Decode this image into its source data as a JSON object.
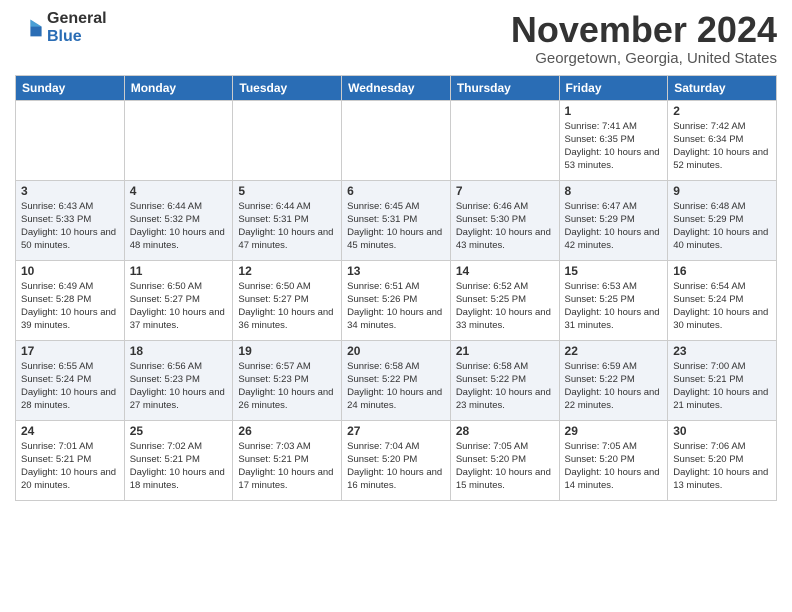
{
  "header": {
    "logo_general": "General",
    "logo_blue": "Blue",
    "month_title": "November 2024",
    "location": "Georgetown, Georgia, United States"
  },
  "weekdays": [
    "Sunday",
    "Monday",
    "Tuesday",
    "Wednesday",
    "Thursday",
    "Friday",
    "Saturday"
  ],
  "weeks": [
    [
      {
        "day": "",
        "info": ""
      },
      {
        "day": "",
        "info": ""
      },
      {
        "day": "",
        "info": ""
      },
      {
        "day": "",
        "info": ""
      },
      {
        "day": "",
        "info": ""
      },
      {
        "day": "1",
        "info": "Sunrise: 7:41 AM\nSunset: 6:35 PM\nDaylight: 10 hours and 53 minutes."
      },
      {
        "day": "2",
        "info": "Sunrise: 7:42 AM\nSunset: 6:34 PM\nDaylight: 10 hours and 52 minutes."
      }
    ],
    [
      {
        "day": "3",
        "info": "Sunrise: 6:43 AM\nSunset: 5:33 PM\nDaylight: 10 hours and 50 minutes."
      },
      {
        "day": "4",
        "info": "Sunrise: 6:44 AM\nSunset: 5:32 PM\nDaylight: 10 hours and 48 minutes."
      },
      {
        "day": "5",
        "info": "Sunrise: 6:44 AM\nSunset: 5:31 PM\nDaylight: 10 hours and 47 minutes."
      },
      {
        "day": "6",
        "info": "Sunrise: 6:45 AM\nSunset: 5:31 PM\nDaylight: 10 hours and 45 minutes."
      },
      {
        "day": "7",
        "info": "Sunrise: 6:46 AM\nSunset: 5:30 PM\nDaylight: 10 hours and 43 minutes."
      },
      {
        "day": "8",
        "info": "Sunrise: 6:47 AM\nSunset: 5:29 PM\nDaylight: 10 hours and 42 minutes."
      },
      {
        "day": "9",
        "info": "Sunrise: 6:48 AM\nSunset: 5:29 PM\nDaylight: 10 hours and 40 minutes."
      }
    ],
    [
      {
        "day": "10",
        "info": "Sunrise: 6:49 AM\nSunset: 5:28 PM\nDaylight: 10 hours and 39 minutes."
      },
      {
        "day": "11",
        "info": "Sunrise: 6:50 AM\nSunset: 5:27 PM\nDaylight: 10 hours and 37 minutes."
      },
      {
        "day": "12",
        "info": "Sunrise: 6:50 AM\nSunset: 5:27 PM\nDaylight: 10 hours and 36 minutes."
      },
      {
        "day": "13",
        "info": "Sunrise: 6:51 AM\nSunset: 5:26 PM\nDaylight: 10 hours and 34 minutes."
      },
      {
        "day": "14",
        "info": "Sunrise: 6:52 AM\nSunset: 5:25 PM\nDaylight: 10 hours and 33 minutes."
      },
      {
        "day": "15",
        "info": "Sunrise: 6:53 AM\nSunset: 5:25 PM\nDaylight: 10 hours and 31 minutes."
      },
      {
        "day": "16",
        "info": "Sunrise: 6:54 AM\nSunset: 5:24 PM\nDaylight: 10 hours and 30 minutes."
      }
    ],
    [
      {
        "day": "17",
        "info": "Sunrise: 6:55 AM\nSunset: 5:24 PM\nDaylight: 10 hours and 28 minutes."
      },
      {
        "day": "18",
        "info": "Sunrise: 6:56 AM\nSunset: 5:23 PM\nDaylight: 10 hours and 27 minutes."
      },
      {
        "day": "19",
        "info": "Sunrise: 6:57 AM\nSunset: 5:23 PM\nDaylight: 10 hours and 26 minutes."
      },
      {
        "day": "20",
        "info": "Sunrise: 6:58 AM\nSunset: 5:22 PM\nDaylight: 10 hours and 24 minutes."
      },
      {
        "day": "21",
        "info": "Sunrise: 6:58 AM\nSunset: 5:22 PM\nDaylight: 10 hours and 23 minutes."
      },
      {
        "day": "22",
        "info": "Sunrise: 6:59 AM\nSunset: 5:22 PM\nDaylight: 10 hours and 22 minutes."
      },
      {
        "day": "23",
        "info": "Sunrise: 7:00 AM\nSunset: 5:21 PM\nDaylight: 10 hours and 21 minutes."
      }
    ],
    [
      {
        "day": "24",
        "info": "Sunrise: 7:01 AM\nSunset: 5:21 PM\nDaylight: 10 hours and 20 minutes."
      },
      {
        "day": "25",
        "info": "Sunrise: 7:02 AM\nSunset: 5:21 PM\nDaylight: 10 hours and 18 minutes."
      },
      {
        "day": "26",
        "info": "Sunrise: 7:03 AM\nSunset: 5:21 PM\nDaylight: 10 hours and 17 minutes."
      },
      {
        "day": "27",
        "info": "Sunrise: 7:04 AM\nSunset: 5:20 PM\nDaylight: 10 hours and 16 minutes."
      },
      {
        "day": "28",
        "info": "Sunrise: 7:05 AM\nSunset: 5:20 PM\nDaylight: 10 hours and 15 minutes."
      },
      {
        "day": "29",
        "info": "Sunrise: 7:05 AM\nSunset: 5:20 PM\nDaylight: 10 hours and 14 minutes."
      },
      {
        "day": "30",
        "info": "Sunrise: 7:06 AM\nSunset: 5:20 PM\nDaylight: 10 hours and 13 minutes."
      }
    ]
  ]
}
